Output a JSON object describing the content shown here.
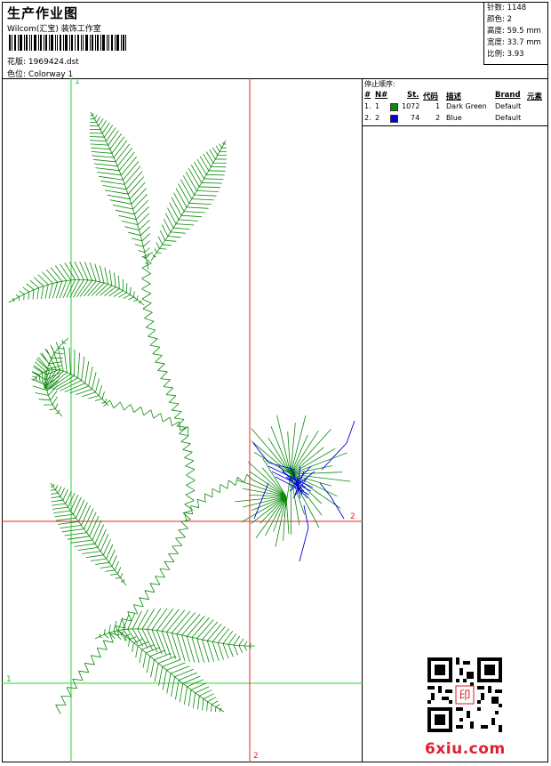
{
  "header": {
    "title": "生产作业图",
    "studio": "Wilcom(汇宝) 装饰工作室",
    "design_label": "花版:",
    "design_file": "1969424.dst",
    "colorway_label": "色位:",
    "colorway": "Colorway 1"
  },
  "info": {
    "stitches": {
      "label": "针数:",
      "value": "1148"
    },
    "colors": {
      "label": "颜色:",
      "value": "2"
    },
    "height": {
      "label": "高度:",
      "value": "59.5 mm"
    },
    "width": {
      "label": "宽度:",
      "value": "33.7 mm"
    },
    "scale": {
      "label": "比例:",
      "value": "3.93"
    }
  },
  "stop_sequence": {
    "label": "停止顺序:",
    "columns": [
      "#",
      "N#",
      "St.",
      "代码",
      "描述",
      "Brand",
      "元素"
    ],
    "rows": [
      {
        "idx": "1.",
        "n": "1",
        "stitches": "1072",
        "code": "1",
        "desc": "Dark Green",
        "brand": "Default",
        "color": "#0a8a0a"
      },
      {
        "idx": "2.",
        "n": "2",
        "stitches": "74",
        "code": "2",
        "desc": "Blue",
        "brand": "Default",
        "color": "#0000e0"
      }
    ]
  },
  "guides": {
    "v_green": "1",
    "h_green": "1",
    "v_red": "2",
    "h_red": "2"
  },
  "watermark": "6xiu.com",
  "qr_seal": "印"
}
